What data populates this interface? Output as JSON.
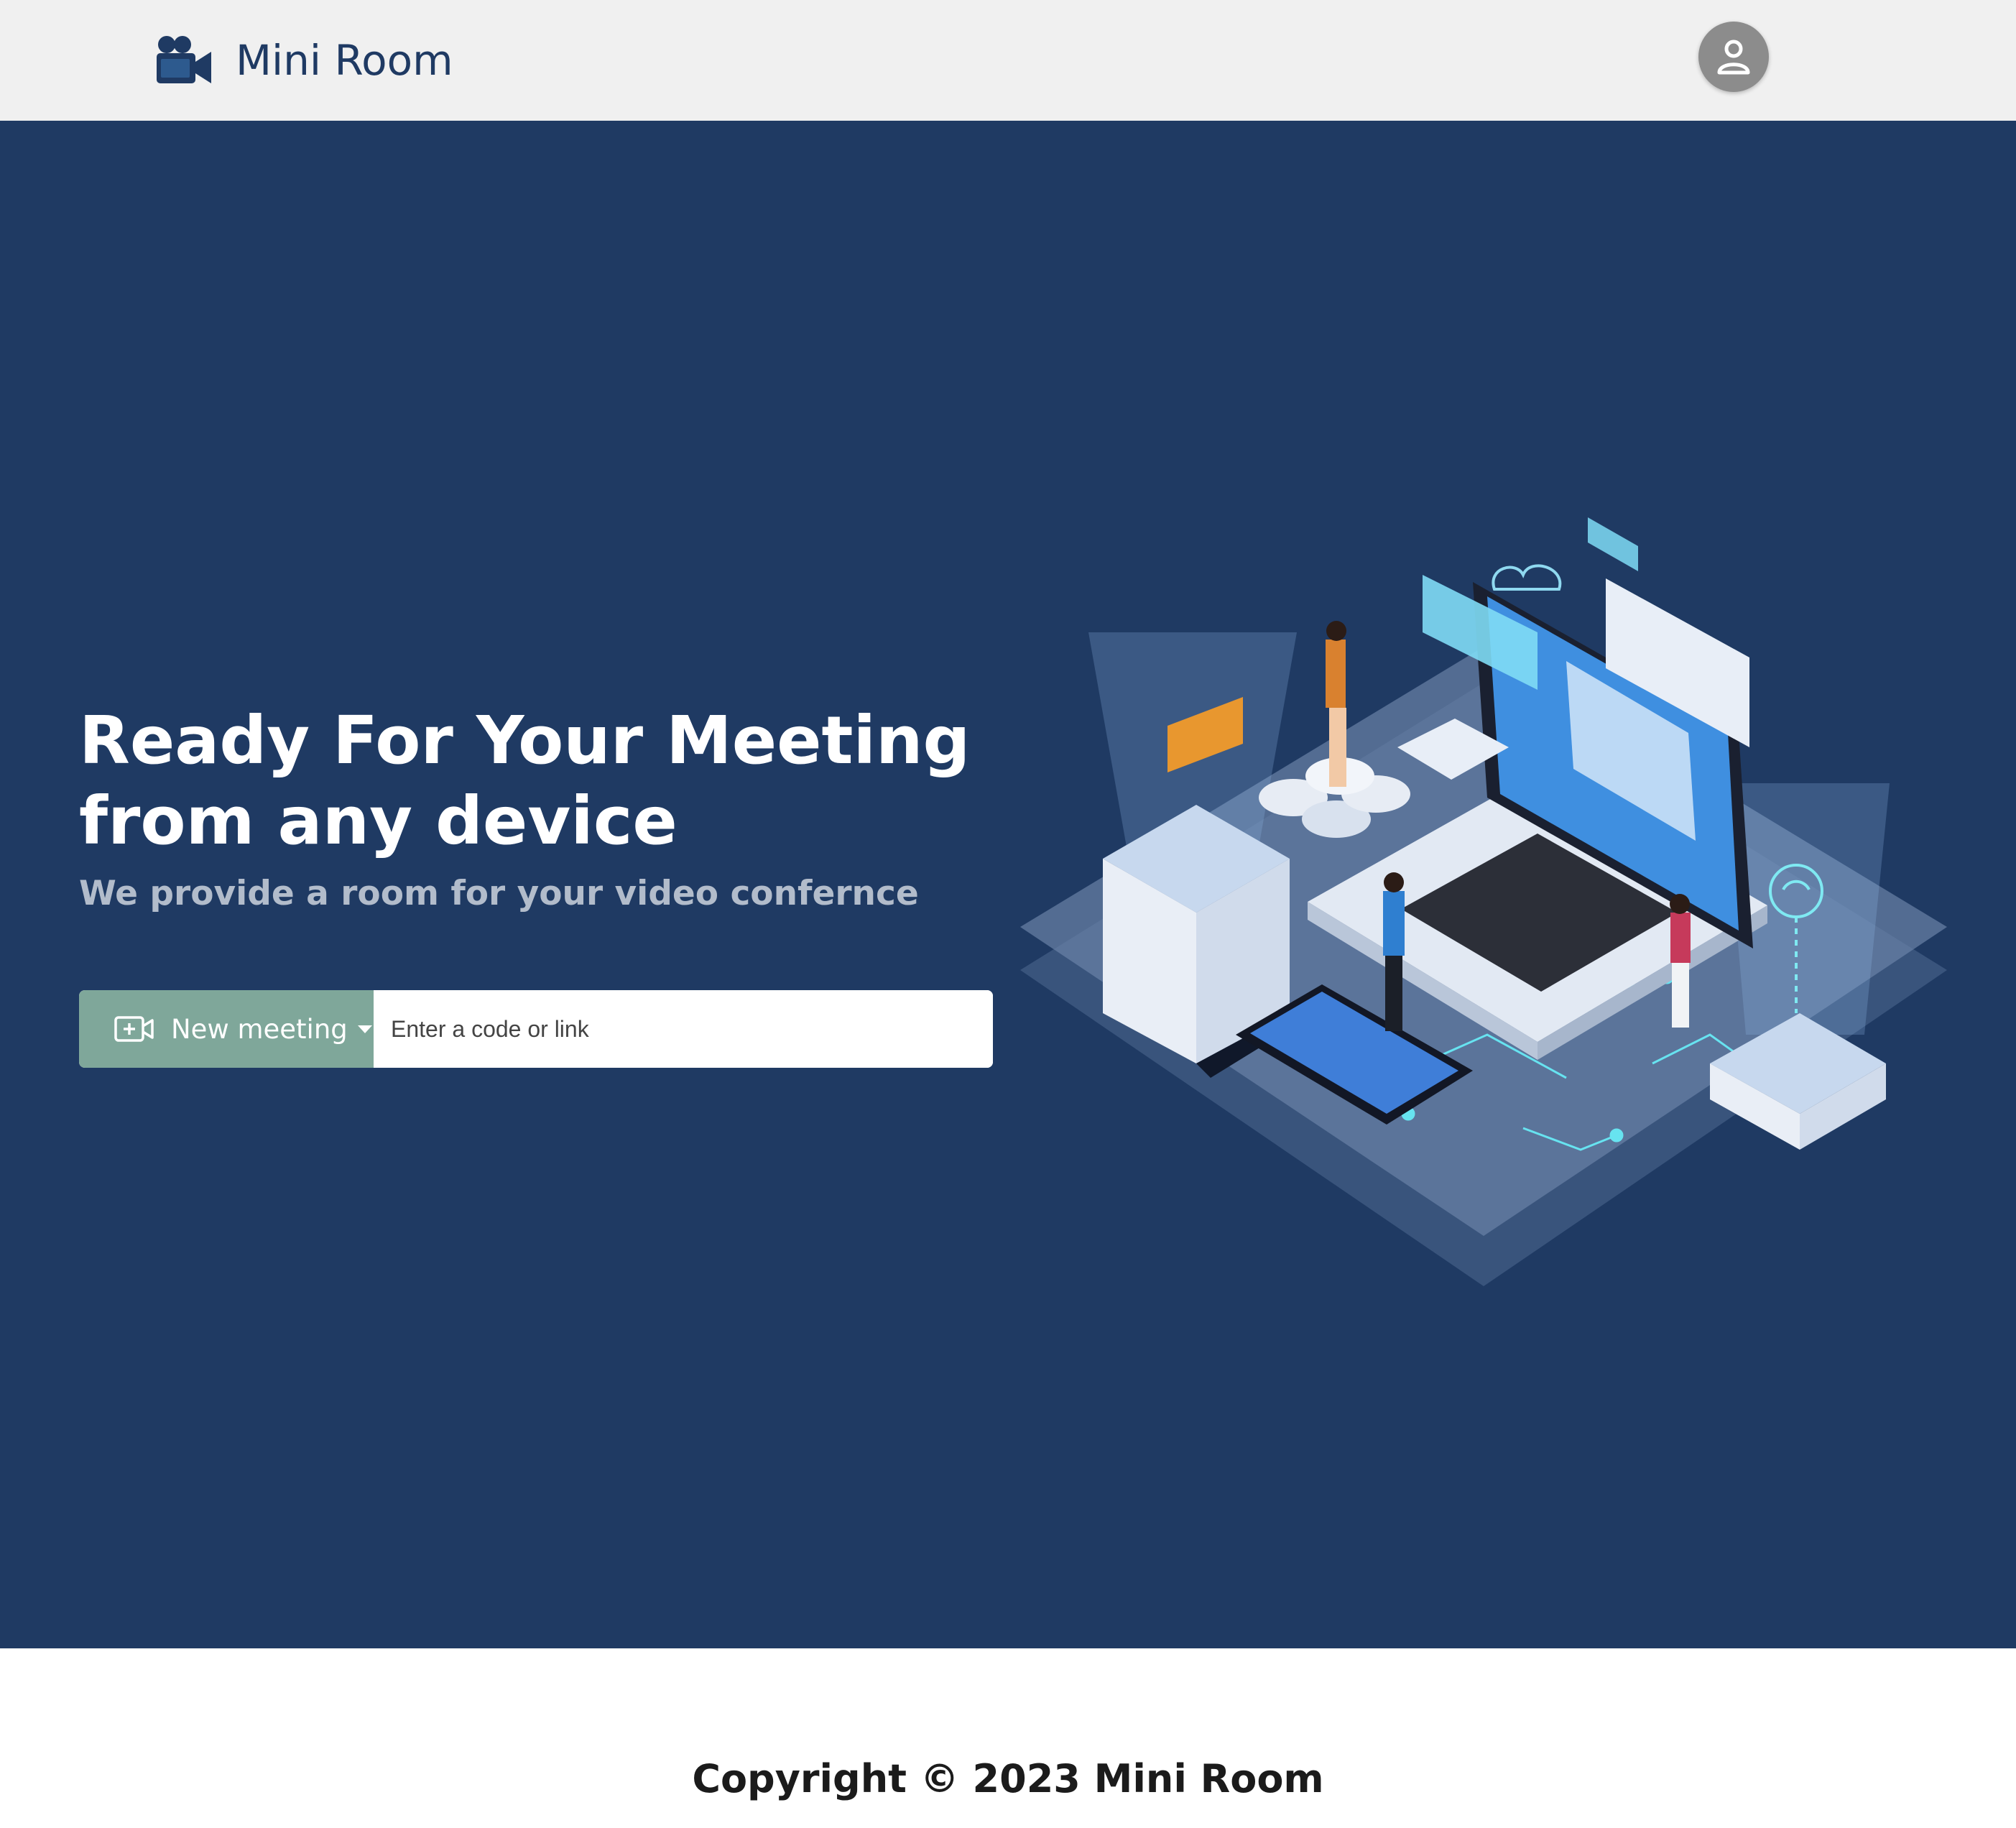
{
  "navbar": {
    "brand_name": "Mini Room",
    "brand_icon": "video-camera-icon",
    "avatar_icon": "user-icon"
  },
  "hero": {
    "headline_line1": "Ready For Your Meeting",
    "headline_line2": "from any device",
    "subheadline": "We provide a room for your video confernce",
    "new_meeting_label": "New meeting",
    "new_meeting_icon": "video-add-icon",
    "code_input_placeholder": "Enter a code or link",
    "code_input_value": ""
  },
  "footer": {
    "copyright": "Copyright © 2023 Mini Room"
  },
  "colors": {
    "navbar_bg": "#f0f0f0",
    "hero_bg": "#1f3a63",
    "brand_text": "#1f3a63",
    "button_bg": "#7fa79a",
    "avatar_bg": "#8c8c8c",
    "subheadline_text": "#b2bccb"
  }
}
